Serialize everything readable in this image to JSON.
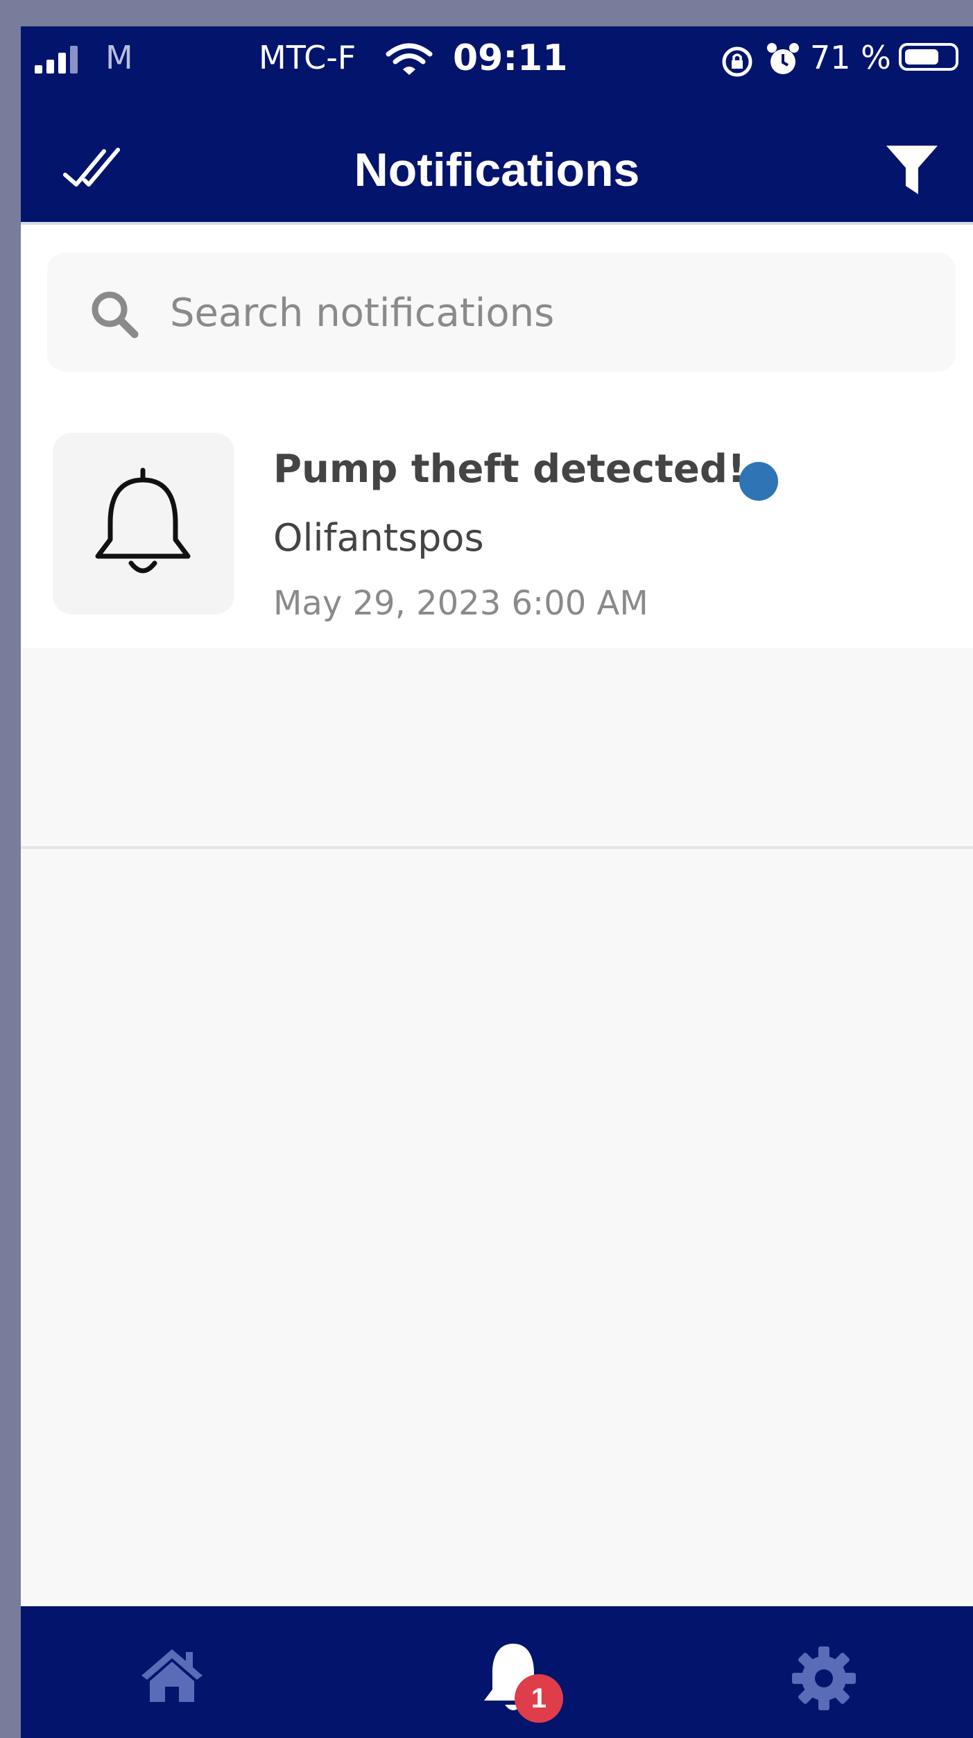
{
  "status_bar": {
    "carrier_left": "M",
    "carrier_right": "MTC-F",
    "time": "09:11",
    "battery_percent": "71 %",
    "battery_level": 0.71,
    "icons": [
      "signal-icon",
      "wifi-icon",
      "orientation-lock-icon",
      "alarm-icon",
      "battery-icon"
    ]
  },
  "header": {
    "title": "Notifications",
    "left_action_icon": "double-check-icon",
    "right_action_icon": "filter-icon"
  },
  "search": {
    "placeholder": "Search notifications",
    "value": ""
  },
  "notifications": [
    {
      "title": "Pump theft detected!",
      "subtitle": "Olifantspos",
      "time": "May 29, 2023 6:00 AM",
      "unread": true,
      "icon": "bell-icon"
    }
  ],
  "tab_bar": {
    "tabs": [
      {
        "icon": "home-icon",
        "active": false
      },
      {
        "icon": "bell-icon",
        "active": true,
        "badge": "1"
      },
      {
        "icon": "gear-icon",
        "active": false
      }
    ]
  },
  "colors": {
    "primary": "#03146c",
    "unread_dot": "#2f74b5",
    "badge": "#e03d4a",
    "tab_icon": "#5a6bb8"
  }
}
